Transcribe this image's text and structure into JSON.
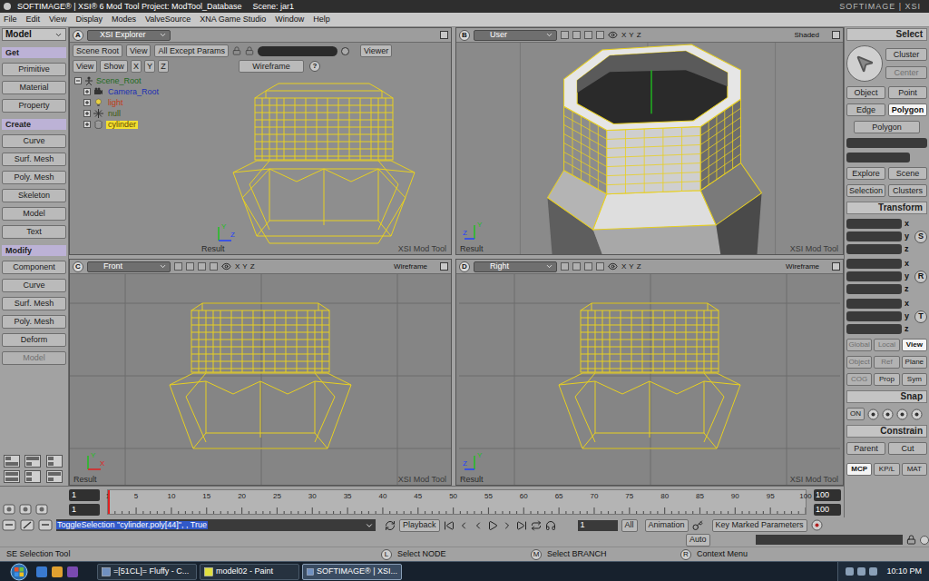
{
  "title_bar": {
    "title": "SOFTIMAGE® | XSI® 6 Mod Tool Project: ModTool_Database",
    "scene": "Scene: jar1",
    "logo": "SOFTIMAGE | XSI"
  },
  "menu": [
    "File",
    "Edit",
    "View",
    "Display",
    "Modes",
    "ValveSource",
    "XNA Game Studio",
    "Window",
    "Help"
  ],
  "left_panel": {
    "mode": "Model",
    "sections": [
      {
        "header": "Get",
        "items": [
          {
            "label": "Primitive",
            "disabled": false
          },
          {
            "label": "Material",
            "disabled": false
          },
          {
            "label": "Property",
            "disabled": false
          }
        ]
      },
      {
        "header": "Create",
        "items": [
          {
            "label": "Curve",
            "disabled": false
          },
          {
            "label": "Surf. Mesh",
            "disabled": false
          },
          {
            "label": "Poly. Mesh",
            "disabled": false
          },
          {
            "label": "Skeleton",
            "disabled": false
          },
          {
            "label": "Model",
            "disabled": false
          },
          {
            "label": "Text",
            "disabled": false
          }
        ]
      },
      {
        "header": "Modify",
        "items": [
          {
            "label": "Component",
            "disabled": false
          },
          {
            "label": "Curve",
            "disabled": false
          },
          {
            "label": "Surf. Mesh",
            "disabled": false
          },
          {
            "label": "Poly. Mesh",
            "disabled": false
          },
          {
            "label": "Deform",
            "disabled": false
          },
          {
            "label": "Model",
            "disabled": true
          }
        ]
      }
    ]
  },
  "explorer": {
    "letter": "A",
    "title": "XSI Explorer",
    "toolbar": [
      "Scene Root",
      "View",
      "All Except Params"
    ],
    "viewer": "Viewer",
    "tree_toolbar": [
      "View",
      "Show"
    ],
    "axes_buttons": [
      "X",
      "Y",
      "Z"
    ],
    "display": "Wireframe",
    "help": "?",
    "tree_root": {
      "label": "Scene_Root",
      "color": "#1f6a1f",
      "expanded": true,
      "selected": false
    },
    "tree_children": [
      {
        "label": "Camera_Root",
        "kind": "camera",
        "color": "#1c2fb4",
        "expanded": false,
        "selected": false
      },
      {
        "label": "light",
        "kind": "light",
        "color": "#c03a18",
        "expanded": false,
        "selected": false
      },
      {
        "label": "null",
        "kind": "null",
        "color": "#3f5a12",
        "expanded": false,
        "selected": false
      },
      {
        "label": "cylinder",
        "kind": "cylinder",
        "color": "#6a4a00",
        "expanded": false,
        "selected": true
      }
    ],
    "axes": [
      {
        "label": "Y",
        "color": "#20c020",
        "direction": "up"
      },
      {
        "label": "Z",
        "color": "#2040ff",
        "direction": "right"
      }
    ],
    "result": "Result",
    "watermark": "XSI Mod Tool"
  },
  "viewports": [
    {
      "letter": "B",
      "camera": "User",
      "axes_buttons": [
        "X",
        "Y",
        "Z"
      ],
      "display": "Shaded",
      "kind": "shaded",
      "axes": [
        {
          "label": "Y",
          "color": "#20c020",
          "direction": "up"
        },
        {
          "label": "Z",
          "color": "#2040ff",
          "direction": "left"
        }
      ],
      "result": "Result",
      "watermark": "XSI Mod Tool"
    },
    {
      "letter": "C",
      "camera": "Front",
      "axes_buttons": [
        "X",
        "Y",
        "Z"
      ],
      "display": "Wireframe",
      "kind": "front",
      "axes": [
        {
          "label": "Y",
          "color": "#20c020",
          "direction": "up"
        },
        {
          "label": "X",
          "color": "#e02020",
          "direction": "right"
        }
      ],
      "result": "Result",
      "watermark": "XSI Mod Tool"
    },
    {
      "letter": "D",
      "camera": "Right",
      "axes_buttons": [
        "X",
        "Y",
        "Z"
      ],
      "display": "Wireframe",
      "kind": "right",
      "axes": [
        {
          "label": "Y",
          "color": "#20c020",
          "direction": "up"
        },
        {
          "label": "Z",
          "color": "#2040ff",
          "direction": "left"
        }
      ],
      "result": "Result",
      "watermark": "XSI Mod Tool"
    }
  ],
  "right_panel": {
    "select": {
      "header": "Select",
      "buttons": [
        {
          "label": "Cluster",
          "disabled": false
        },
        {
          "label": "Center",
          "disabled": true
        }
      ],
      "filters": [
        {
          "label": "Object",
          "selected": false
        },
        {
          "label": "Point",
          "selected": false
        },
        {
          "label": "Edge",
          "selected": false
        },
        {
          "label": "Polygon",
          "selected": true
        }
      ],
      "filter_menu": "Polygon",
      "actions": [
        "Explore",
        "Scene",
        "Selection",
        "Clusters"
      ]
    },
    "transform": {
      "header": "Transform",
      "groups": [
        {
          "label": "S",
          "axes": [
            "x",
            "y",
            "z"
          ]
        },
        {
          "label": "R",
          "axes": [
            "x",
            "y",
            "z"
          ]
        },
        {
          "label": "T",
          "axes": [
            "x",
            "y",
            "z"
          ]
        }
      ],
      "modes": [
        {
          "label": "Global",
          "selected": false,
          "disabled": true
        },
        {
          "label": "Local",
          "selected": false,
          "disabled": true
        },
        {
          "label": "View",
          "selected": true,
          "disabled": false
        }
      ],
      "refs": [
        {
          "label": "Object",
          "disabled": true
        },
        {
          "label": "Ref",
          "disabled": true
        },
        {
          "label": "Plane",
          "disabled": false
        }
      ],
      "extras": [
        {
          "label": "COG",
          "disabled": true
        },
        {
          "label": "Prop",
          "disabled": false
        },
        {
          "label": "Sym",
          "disabled": false
        }
      ]
    },
    "snap": {
      "header": "Snap",
      "toggle": "ON"
    },
    "constrain": {
      "header": "Constrain",
      "buttons": [
        "Parent",
        "Cut"
      ]
    },
    "tabs": [
      {
        "label": "MCP",
        "selected": true
      },
      {
        "label": "KP/L",
        "selected": false
      },
      {
        "label": "MAT",
        "selected": false
      }
    ]
  },
  "timeline": {
    "start": "1",
    "start2": "1",
    "end": "100",
    "end2": "100",
    "current_frame": "1",
    "ticks": [
      "1",
      "5",
      "10",
      "15",
      "20",
      "25",
      "30",
      "35",
      "40",
      "45",
      "50",
      "55",
      "60",
      "65",
      "70",
      "75",
      "80",
      "85",
      "90",
      "95",
      "100"
    ]
  },
  "command_bar": {
    "command": "ToggleSelection \"cylinder.poly[44]\", , True",
    "playback": "Playback",
    "frame": "1",
    "range": "All",
    "animation": "Animation",
    "key_button": "Key Marked Parameters",
    "auto": "Auto"
  },
  "status_bar": {
    "tool": "SE Selection Tool",
    "mouse": [
      {
        "key": "L",
        "label": "Select NODE"
      },
      {
        "key": "M",
        "label": "Select BRANCH"
      },
      {
        "key": "R",
        "label": "Context Menu"
      }
    ]
  },
  "taskbar": {
    "items": [
      {
        "label": "=[51CL]= Fluffy - C...",
        "selected": false
      },
      {
        "label": "model02 - Paint",
        "selected": false
      },
      {
        "label": "SOFTIMAGE® | XSI...",
        "selected": true
      }
    ],
    "clock": "10:10 PM"
  }
}
